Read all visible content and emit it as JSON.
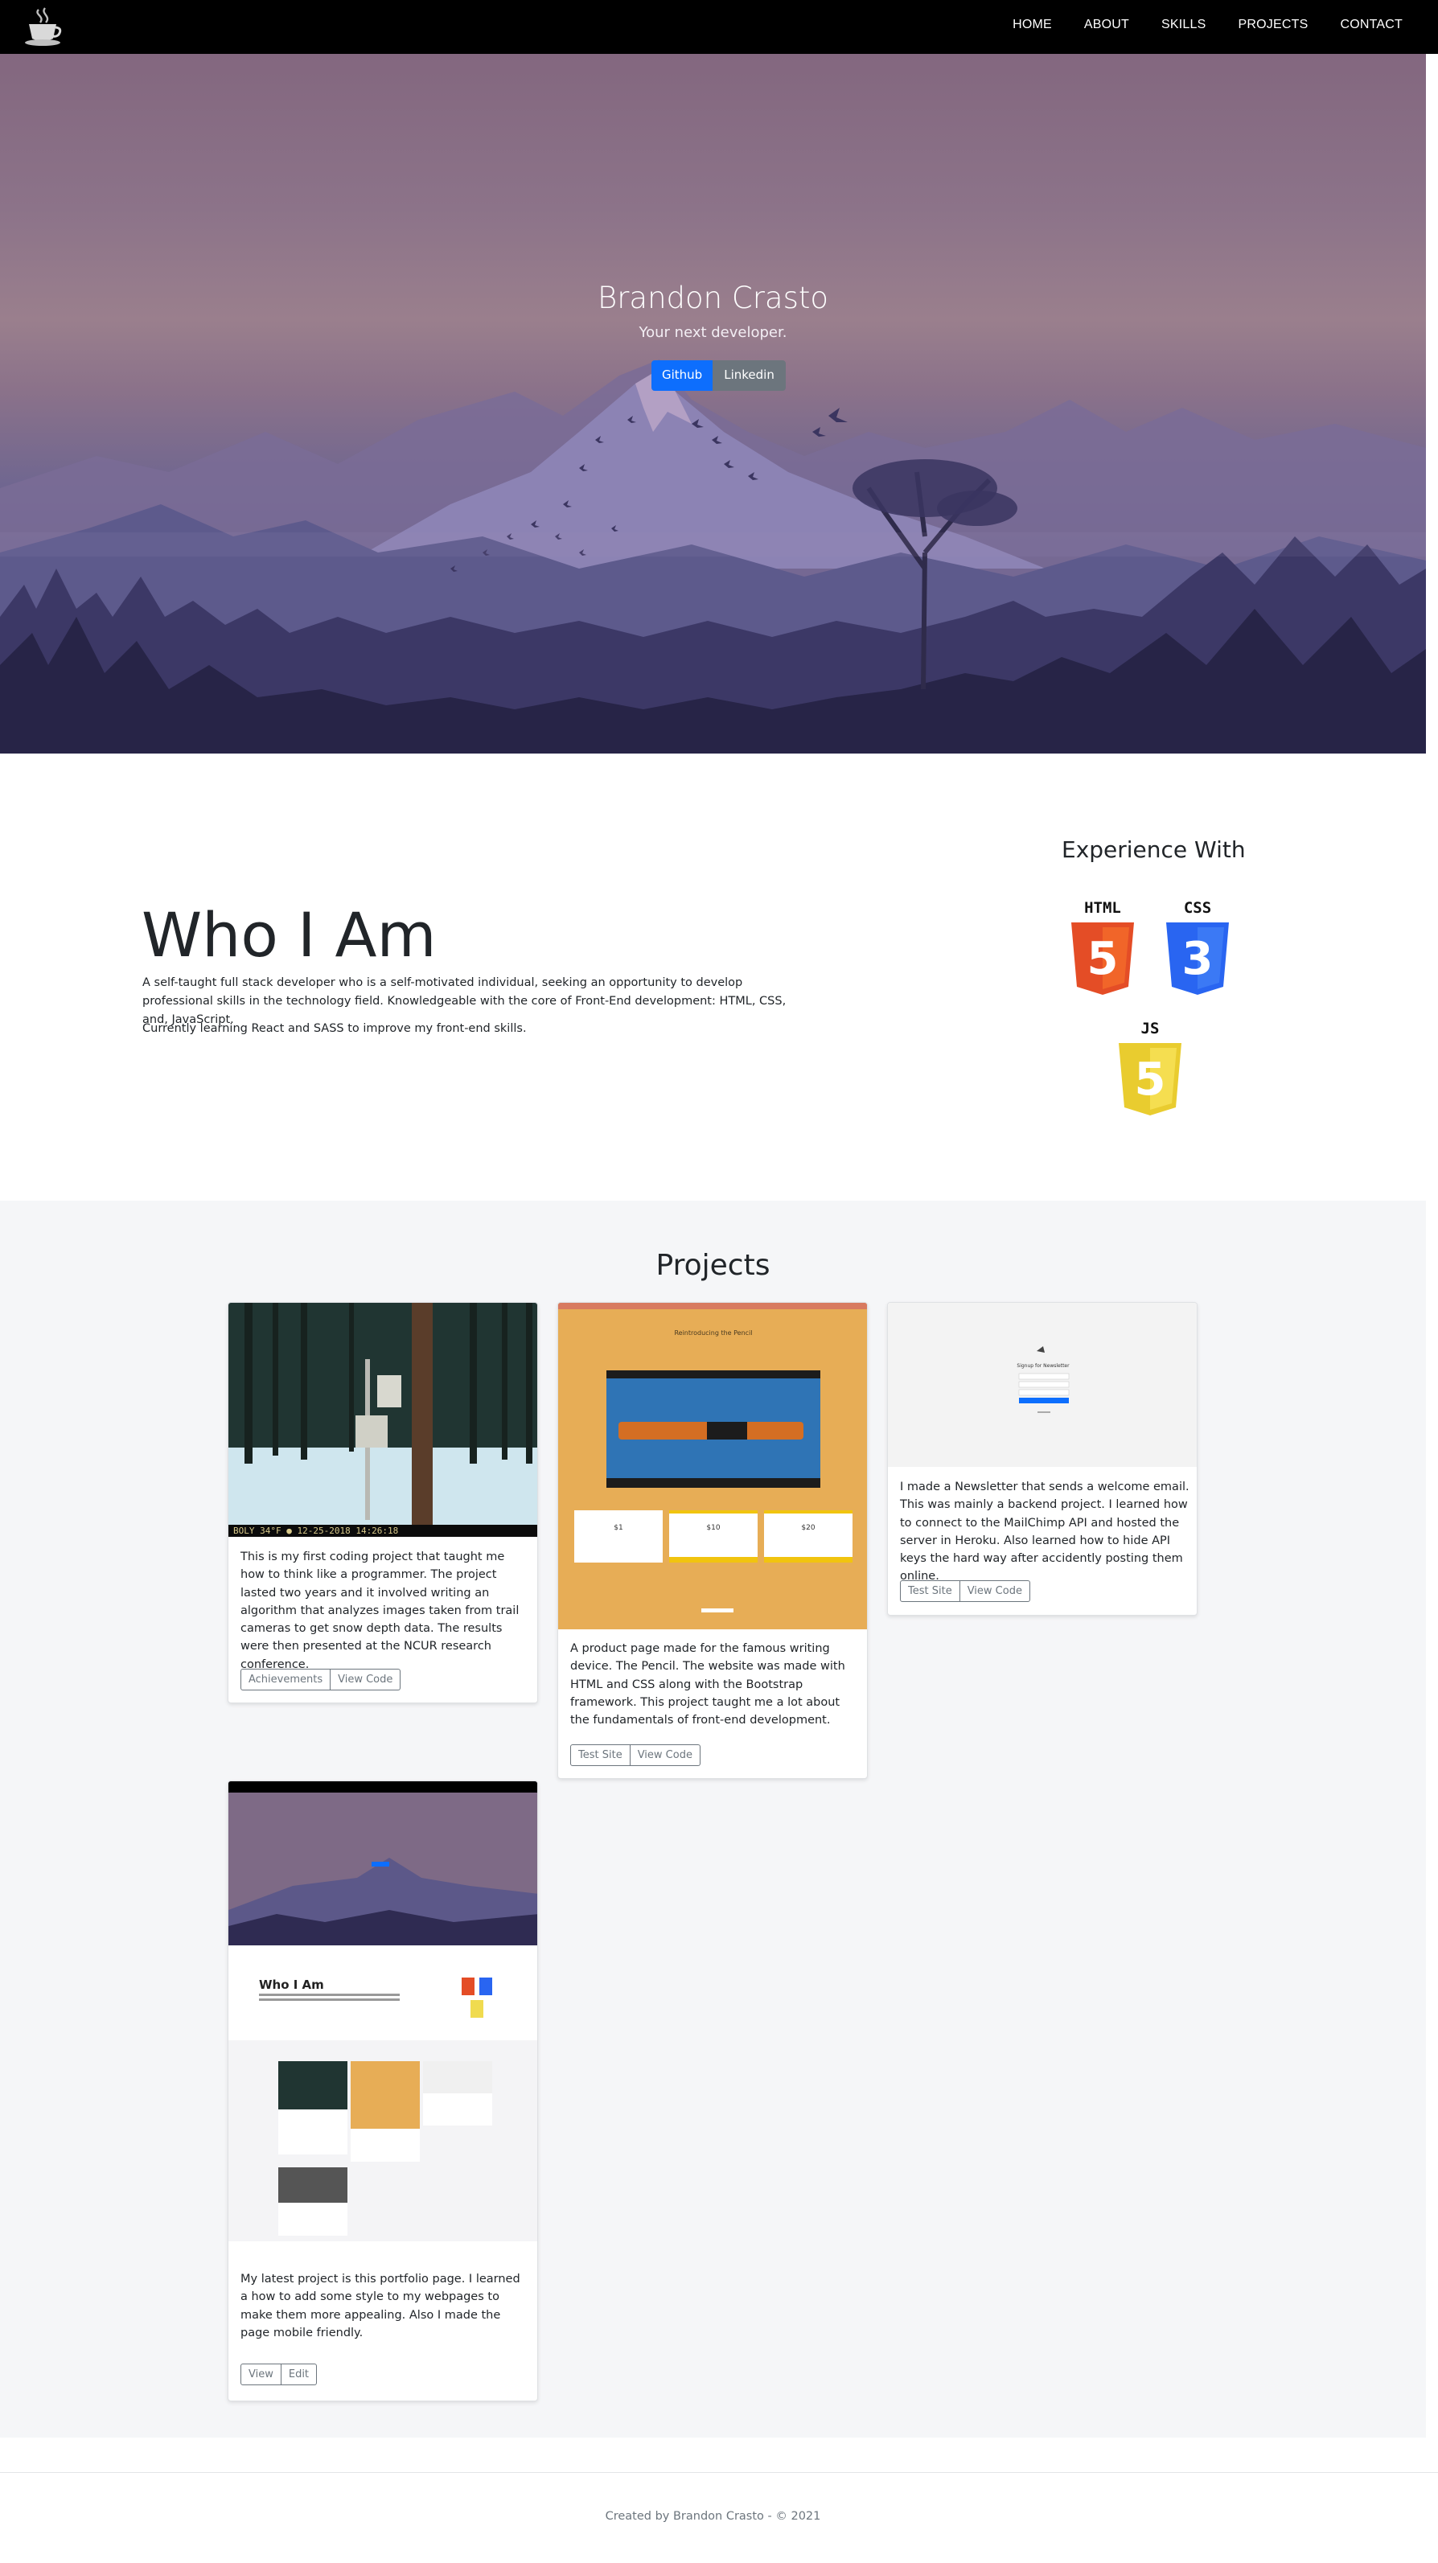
{
  "nav": {
    "brand_icon": "coffee-cup-logo",
    "links": [
      "HOME",
      "ABOUT",
      "SKILLS",
      "PROJECTS",
      "CONTACT"
    ]
  },
  "hero": {
    "title": "Brandon Crasto",
    "subtitle": "Your next developer.",
    "github_label": "Github",
    "linkedin_label": "Linkedin"
  },
  "about": {
    "title": "Who I Am",
    "p1": "A self-taught full stack developer who is a self-motivated individual, seeking an opportunity to develop professional skills in the technology field. Knowledgeable with the core of Front-End development: HTML, CSS, and, JavaScript.",
    "p2": "Currently learning React and SASS to improve my front-end skills.",
    "experience_title": "Experience With",
    "skills": [
      {
        "name": "HTML",
        "number": "5",
        "color": "#e44d26"
      },
      {
        "name": "CSS",
        "number": "3",
        "color": "#2965f1"
      },
      {
        "name": "JS",
        "number": "5",
        "color": "#f0db4f"
      }
    ]
  },
  "projects": {
    "title": "Projects",
    "cards": [
      {
        "text": "This is my first coding project that taught me how to think like a programmer. The project lasted two years and it involved writing an algorithm that analyzes images taken from trail cameras to get snow depth data. The results were then presented at the NCUR research conference.",
        "buttons": [
          "Achievements",
          "View Code"
        ],
        "image_caption": "BOLY   34°F   ●   12-25-2018   14:26:18"
      },
      {
        "text": "A product page made for the famous writing device. The Pencil. The website was made with HTML and CSS along with the Bootstrap framework. This project taught me a lot about the fundamentals of front-end development.",
        "buttons": [
          "Test Site",
          "View Code"
        ],
        "image_caption": "Reintroducing the Pencil",
        "prices": [
          "$1",
          "$10",
          "$20"
        ]
      },
      {
        "text": "I made a Newsletter that sends a welcome email. This was mainly a backend project. I learned how to connect to the MailChimp API and hosted the server in Heroku. Also learned how to hide API keys the hard way after accidently posting them online.",
        "buttons": [
          "Test Site",
          "View Code"
        ],
        "image_caption": "Signup for Newsletter"
      },
      {
        "text": "My latest project is this portfolio page. I learned a how to add some style to my webpages to make them more appealing. Also I made the page mobile friendly.",
        "buttons": [
          "View",
          "Edit"
        ],
        "image_caption": "Who I Am"
      }
    ]
  },
  "footer": {
    "text": "Created by Brandon Crasto - © 2021"
  }
}
